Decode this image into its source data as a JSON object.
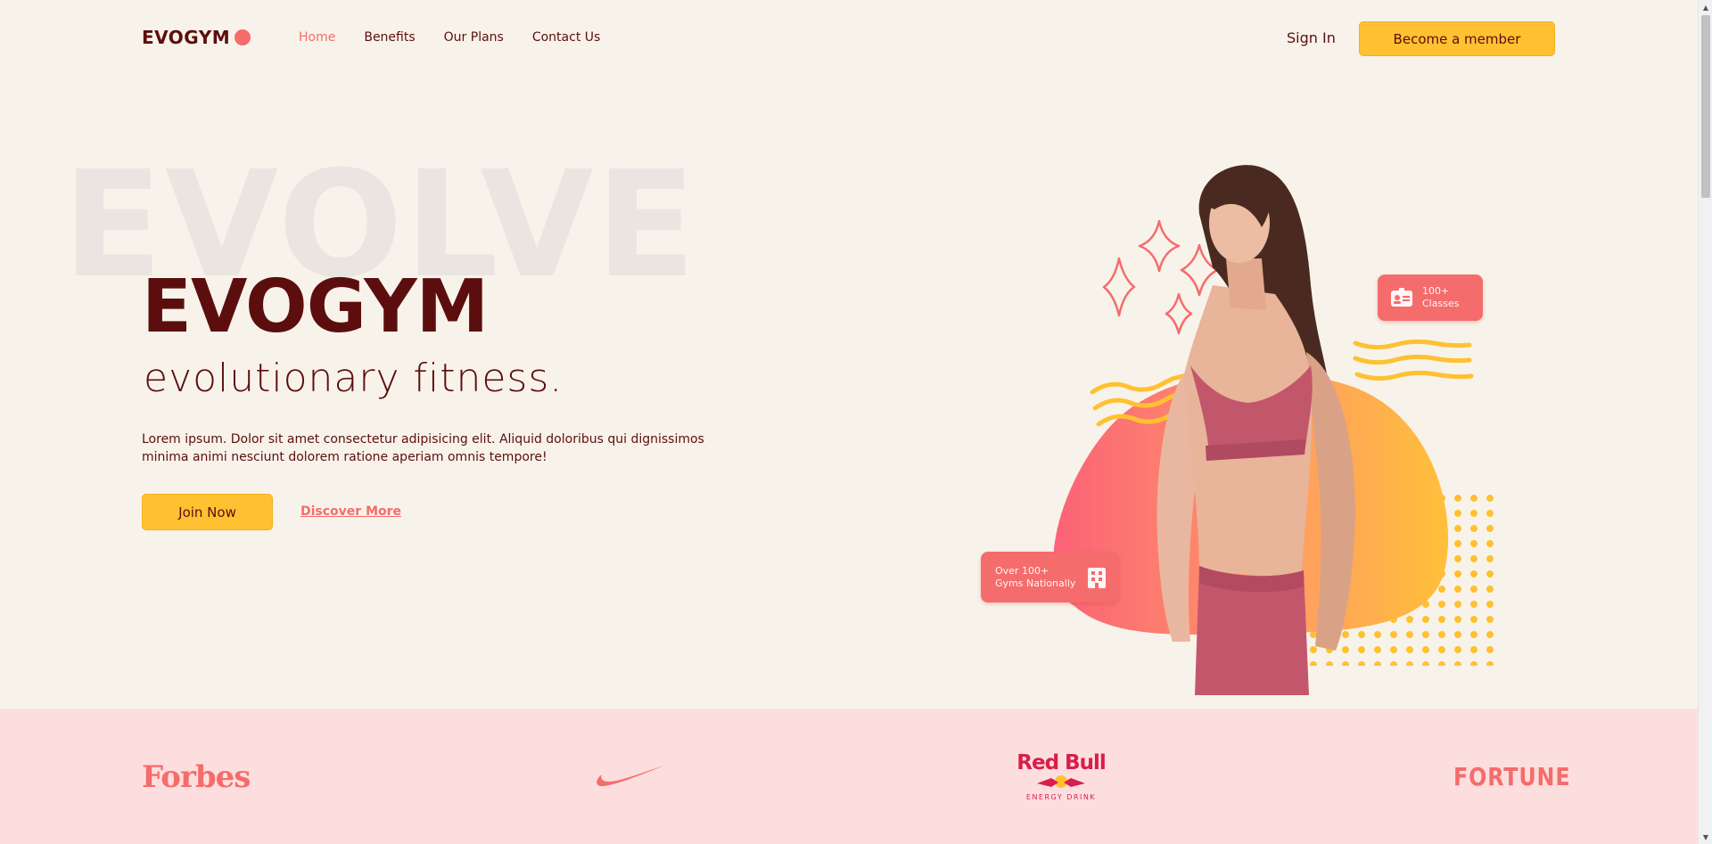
{
  "brand": {
    "name": "EVOGYM"
  },
  "nav": {
    "links": [
      {
        "label": "Home",
        "active": true
      },
      {
        "label": "Benefits",
        "active": false
      },
      {
        "label": "Our Plans",
        "active": false
      },
      {
        "label": "Contact Us",
        "active": false
      }
    ],
    "sign_in": "Sign In",
    "member_button": "Become a member"
  },
  "hero": {
    "background_word": "EVOLVE",
    "title": "EVOGYM",
    "subtitle": "evolutionary fitness.",
    "description": "Lorem ipsum. Dolor sit amet consectetur adipisicing elit. Aliquid doloribus qui dignissimos minima animi nesciunt dolorem ratione aperiam omnis tempore!",
    "join_button": "Join Now",
    "discover_link": "Discover More",
    "badge_classes": {
      "line1": "100+",
      "line2": "Classes",
      "icon": "id-card-icon"
    },
    "badge_gyms": {
      "line1": "Over 100+",
      "line2": "Gyms Nationally",
      "icon": "building-icon"
    }
  },
  "sponsors": {
    "forbes": "Forbes",
    "nike": "nike-swoosh-logo",
    "redbull": {
      "name": "Red Bull",
      "tagline": "ENERGY DRINK"
    },
    "fortune": "FORTUNE"
  },
  "colors": {
    "primary_dark": "#5c0e0e",
    "accent_red": "#f56c6c",
    "accent_yellow": "#ffc132",
    "bg_cream": "#f8f3ea",
    "bg_pink": "#fddede"
  }
}
